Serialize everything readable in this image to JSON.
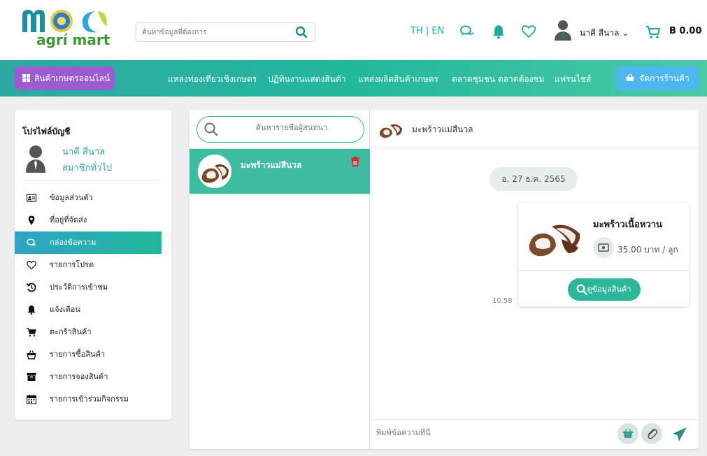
{
  "brand": {
    "logo_word": "agrí mart"
  },
  "search": {
    "placeholder": "ค้นหาข้อมูลที่ต้องการ"
  },
  "header": {
    "language": "TH | EN",
    "user_name": "นาคี สีนาล",
    "cart_total": "B 0.00",
    "icons": [
      "search-icon",
      "chat-icon",
      "bell-icon",
      "heart-icon",
      "user-icon",
      "chevron-down-icon",
      "cart-icon"
    ]
  },
  "navbar": {
    "category_button": "สินค้าเกษตรออนไลน์",
    "links": [
      "แหล่งท่องเที่ยวเชิงเกษตร",
      "ปฏิทินงานแสดงสินค้า",
      "แหล่งผลิตสินค้าเกษตร",
      "ตลาดชุมชน ตลาดต้องชม",
      "แฟรนไชส์"
    ],
    "manage_store": "จัดการร้านค้า"
  },
  "sidebar": {
    "title": "โปรไฟล์บัญชี",
    "user_name": "นาคี สีนาล",
    "user_role": "สมาชิกทั่วไป",
    "items": [
      {
        "label": "ข้อมูลส่วนตัว",
        "icon": "id-card-icon",
        "active": false
      },
      {
        "label": "ที่อยู่ที่จัดส่ง",
        "icon": "map-pin-icon",
        "active": false
      },
      {
        "label": "กล่องข้อความ",
        "icon": "chat-icon",
        "active": true
      },
      {
        "label": "รายการโปรด",
        "icon": "heart-icon",
        "active": false
      },
      {
        "label": "ประวัติการเข้าชม",
        "icon": "history-icon",
        "active": false
      },
      {
        "label": "แจ้งเตือน",
        "icon": "bell-icon",
        "active": false
      },
      {
        "label": "ตะกร้าสินค้า",
        "icon": "cart-icon",
        "active": false
      },
      {
        "label": "รายการซื้อสินค้า",
        "icon": "basket-icon",
        "active": false
      },
      {
        "label": "รายการจองสินค้า",
        "icon": "archive-icon",
        "active": false
      },
      {
        "label": "รายการเข้าร่วมกิจกรรม",
        "icon": "calendar-icon",
        "active": false
      }
    ]
  },
  "chat": {
    "search_placeholder": "ค้นหารายชื่อผู้สนทนา",
    "contacts": [
      {
        "name": "มะพร้าวแม่สีนวล",
        "selected": true
      }
    ],
    "active_contact": "มะพร้าวแม่สีนวล",
    "date_label": "อ. 27 ธ.ค. 2565",
    "message": {
      "product_name": "มะพร้าวเนื้อหวาน",
      "price": "35.00 บาท / ลูก",
      "button": "ดูข้อมูลสินค้า",
      "time": "10.58"
    },
    "composer_placeholder": "พิมพ์ข้อความที่นี่"
  },
  "colors": {
    "teal": "#2eb69b",
    "purple": "#9c5cd1",
    "blue_button": "#4db8f0",
    "delete_red": "#d9231d"
  }
}
